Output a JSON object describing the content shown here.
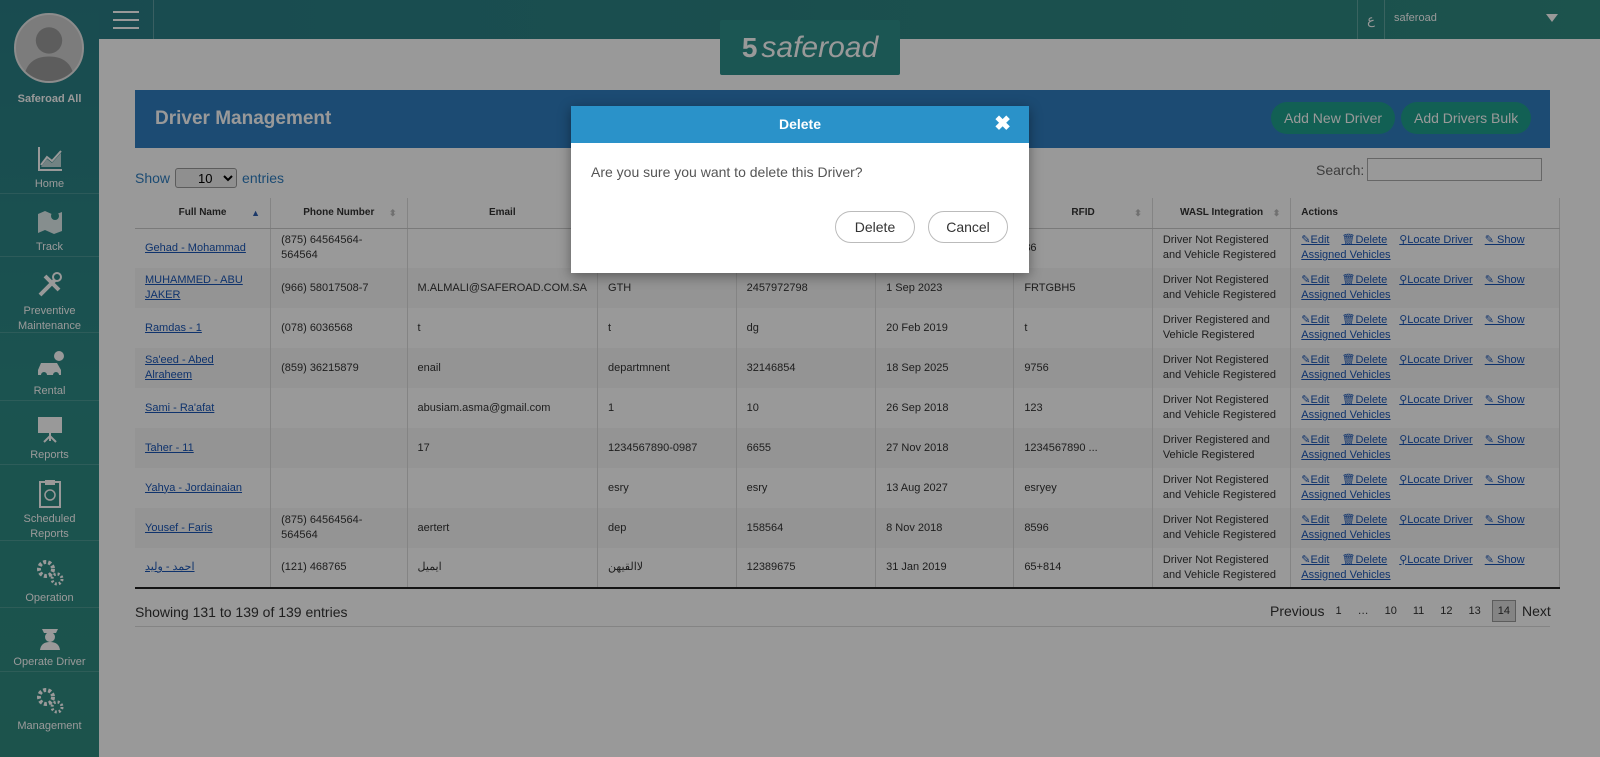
{
  "sidebar": {
    "user_name": "Saferoad All",
    "items": [
      {
        "label_1": "Home",
        "label_2": ""
      },
      {
        "label_1": "Track",
        "label_2": ""
      },
      {
        "label_1": "Preventive",
        "label_2": "Maintenance"
      },
      {
        "label_1": "Rental",
        "label_2": ""
      },
      {
        "label_1": "Reports",
        "label_2": ""
      },
      {
        "label_1": "Scheduled",
        "label_2": "Reports"
      },
      {
        "label_1": "Operation",
        "label_2": ""
      },
      {
        "label_1": "Operate Driver",
        "label_2": ""
      },
      {
        "label_1": "Management",
        "label_2": ""
      }
    ]
  },
  "topbar": {
    "lang_label": "ع",
    "user_label": "saferoad",
    "logo_text": "saferoad"
  },
  "panel": {
    "title": "Driver Management",
    "add_new_label": "Add New Driver",
    "add_bulk_label": "Add Drivers Bulk"
  },
  "table_controls": {
    "show_label": "Show",
    "entries_value": "10",
    "entries_label": "entries",
    "search_label": "Search:"
  },
  "table": {
    "headers": [
      "Full Name",
      "Phone Number",
      "Email",
      "",
      "",
      "",
      "RFID",
      "WASL Integration",
      "Actions"
    ],
    "rows": [
      {
        "name": "Gehad - Mohammad",
        "phone": "(875) 64564564-564564",
        "email": "",
        "dept": "",
        "id": "",
        "date": "",
        "rfid": "86",
        "wasl_1": "Driver Not Registered",
        "wasl_2": "and Vehicle Registered"
      },
      {
        "name": "MUHAMMED - ABU JAKER",
        "phone": "(966) 58017508-7",
        "email": "M.ALMALI@SAFEROAD.COM.SA",
        "dept": "GTH",
        "id": "2457972798",
        "date": "1 Sep 2023",
        "rfid": "FRTGBH5",
        "wasl_1": "Driver Not Registered",
        "wasl_2": "and Vehicle Registered"
      },
      {
        "name": "Ramdas - 1",
        "phone": "(078) 6036568",
        "email": "t",
        "dept": "t",
        "id": "dg",
        "date": "20 Feb 2019",
        "rfid": "t",
        "wasl_1": "Driver Registered and",
        "wasl_2": "Vehicle Registered"
      },
      {
        "name": "Sa'eed - Abed Alraheem",
        "phone": "(859) 36215879",
        "email": "enail",
        "dept": "departmnent",
        "id": "32146854",
        "date": "18 Sep 2025",
        "rfid": "9756",
        "wasl_1": "Driver Not Registered",
        "wasl_2": "and Vehicle Registered"
      },
      {
        "name": "Sami - Ra'afat",
        "phone": "",
        "email": "abusiam.asma@gmail.com",
        "dept": "1",
        "id": "10",
        "date": "26 Sep 2018",
        "rfid": "123",
        "wasl_1": "Driver Not Registered",
        "wasl_2": "and Vehicle Registered"
      },
      {
        "name": "Taher - 11",
        "phone": "",
        "email": "17",
        "dept": "1234567890-0987",
        "id": "6655",
        "date": "27 Nov 2018",
        "rfid": "1234567890 ...",
        "wasl_1": "Driver Registered and",
        "wasl_2": "Vehicle Registered"
      },
      {
        "name": "Yahya - Jordainaian",
        "phone": "",
        "email": "",
        "dept": "esry",
        "id": "esry",
        "date": "13 Aug 2027",
        "rfid": "esryey",
        "wasl_1": "Driver Not Registered",
        "wasl_2": "and Vehicle Registered"
      },
      {
        "name": "Yousef - Faris",
        "phone": "(875) 64564564-564564",
        "email": "aertert",
        "dept": "dep",
        "id": "158564",
        "date": "8 Nov 2018",
        "rfid": "8596",
        "wasl_1": "Driver Not Registered",
        "wasl_2": "and Vehicle Registered"
      },
      {
        "name": "احمد - وليد",
        "phone": "(121) 468765",
        "email": "ايميل",
        "dept": "لاالقيهن",
        "id": "12389675",
        "date": "31 Jan 2019",
        "rfid": "65+814",
        "wasl_1": "Driver Not Registered",
        "wasl_2": "and Vehicle Registered"
      }
    ],
    "actions": {
      "edit": "Edit",
      "delete": "Delete",
      "locate": "Locate Driver",
      "show": "Show",
      "assigned": "Assigned Vehicles"
    }
  },
  "footer": {
    "info": "Showing 131 to 139 of 139 entries",
    "pager": [
      "Previous",
      "1",
      "…",
      "10",
      "11",
      "12",
      "13",
      "14",
      "Next"
    ]
  },
  "modal": {
    "title": "Delete",
    "message": "Are you sure you want to delete this Driver?",
    "delete_label": "Delete",
    "cancel_label": "Cancel"
  },
  "colors": {
    "sidebar": "#2a7e86",
    "panel_header": "#2f7ec0",
    "modal_header": "#2a92c9",
    "accent_button": "#1fa08c"
  }
}
